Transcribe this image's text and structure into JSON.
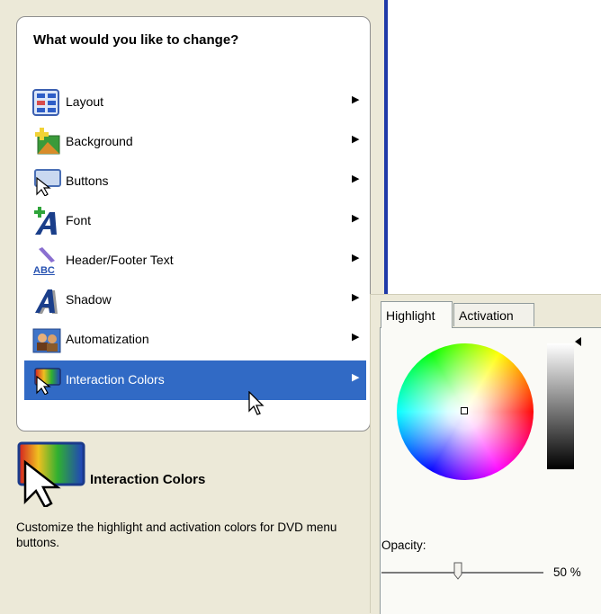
{
  "menu": {
    "title": "What would you like to change?",
    "items": [
      {
        "label": "Layout",
        "icon": "layout-icon"
      },
      {
        "label": "Background",
        "icon": "background-icon"
      },
      {
        "label": "Buttons",
        "icon": "buttons-icon"
      },
      {
        "label": "Font",
        "icon": "font-icon"
      },
      {
        "label": "Header/Footer Text",
        "icon": "header-footer-text-icon"
      },
      {
        "label": "Shadow",
        "icon": "shadow-icon"
      },
      {
        "label": "Automatization",
        "icon": "automatization-icon"
      },
      {
        "label": "Interaction Colors",
        "icon": "interaction-colors-icon",
        "selected": true
      }
    ],
    "submenu_arrow": "▶"
  },
  "description": {
    "title": "Interaction Colors",
    "text": "Customize the highlight and activation colors for DVD menu buttons."
  },
  "color_panel": {
    "tabs": [
      {
        "label": "Highlight",
        "active": true
      },
      {
        "label": "Activation",
        "active": false
      }
    ],
    "opacity_label": "Opacity:",
    "opacity_value": "50 %",
    "opacity_fraction": 0.5
  },
  "colors": {
    "selection": "#316ac5",
    "panel_bg": "#ece9d8",
    "accent_bar": "#1f3aa8"
  }
}
